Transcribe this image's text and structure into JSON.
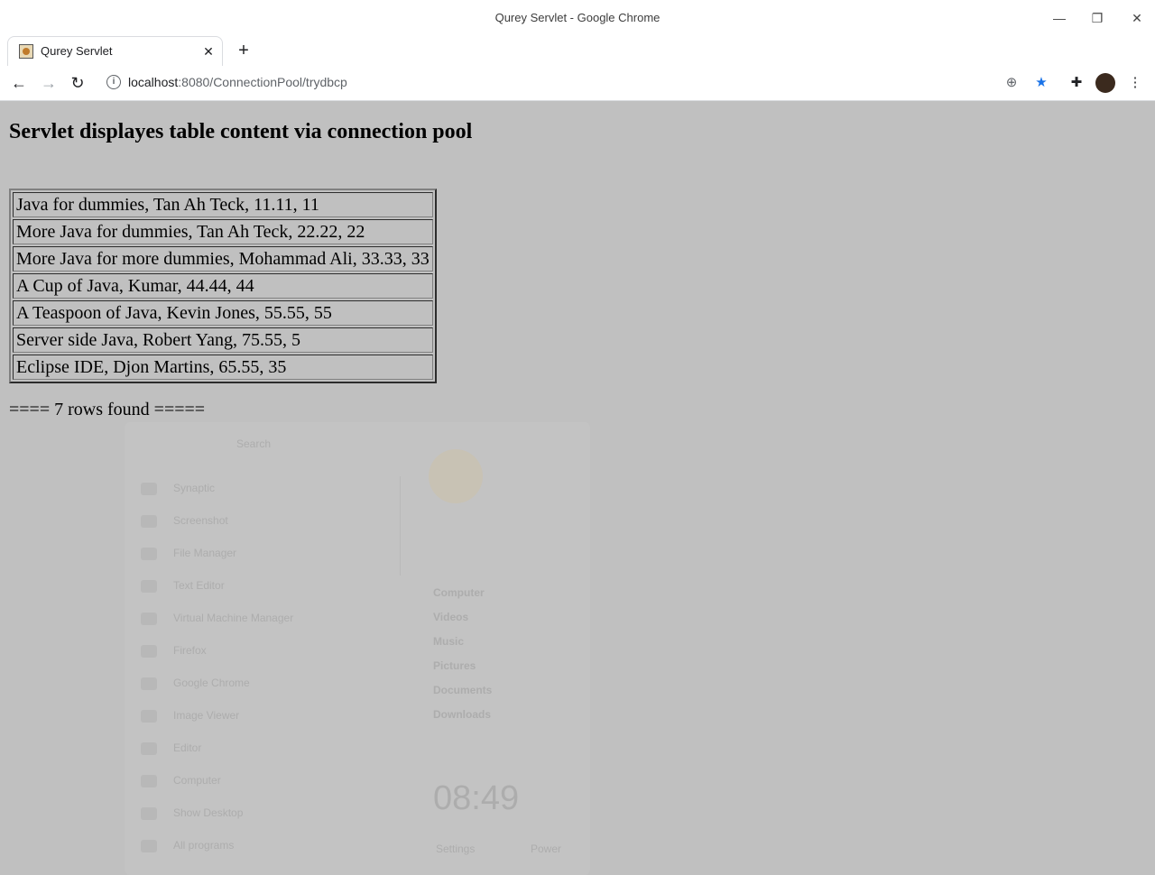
{
  "window": {
    "title": "Qurey Servlet - Google Chrome"
  },
  "tab": {
    "title": "Qurey Servlet",
    "close": "✕",
    "new_tab": "+"
  },
  "toolbar": {
    "url_host": "localhost",
    "url_rest": ":8080/ConnectionPool/trydbcp"
  },
  "page": {
    "heading": "Servlet displayes table content via connection pool",
    "rows": [
      "Java for dummies, Tan Ah Teck, 11.11, 11",
      "More Java for dummies, Tan Ah Teck, 22.22, 22",
      "More Java for more dummies, Mohammad Ali, 33.33, 33",
      "A Cup of Java, Kumar, 44.44, 44",
      "A Teaspoon of Java, Kevin Jones, 55.55, 55",
      "Server side Java, Robert Yang, 75.55, 5",
      "Eclipse IDE, Djon Martins, 65.55, 35"
    ],
    "footer": "==== 7 rows found ====="
  },
  "menu": {
    "search_placeholder": "Search",
    "apps": [
      "Synaptic",
      "Screenshot",
      "File Manager",
      "Text Editor",
      "Virtual Machine Manager",
      "Firefox",
      "Google Chrome",
      "Image Viewer",
      "Editor",
      "Computer",
      "Show Desktop",
      "All programs"
    ],
    "places": [
      "Computer",
      "Videos",
      "Music",
      "Pictures",
      "Documents",
      "Downloads"
    ],
    "clock": "08:49",
    "settings": "Settings",
    "power": "Power"
  }
}
